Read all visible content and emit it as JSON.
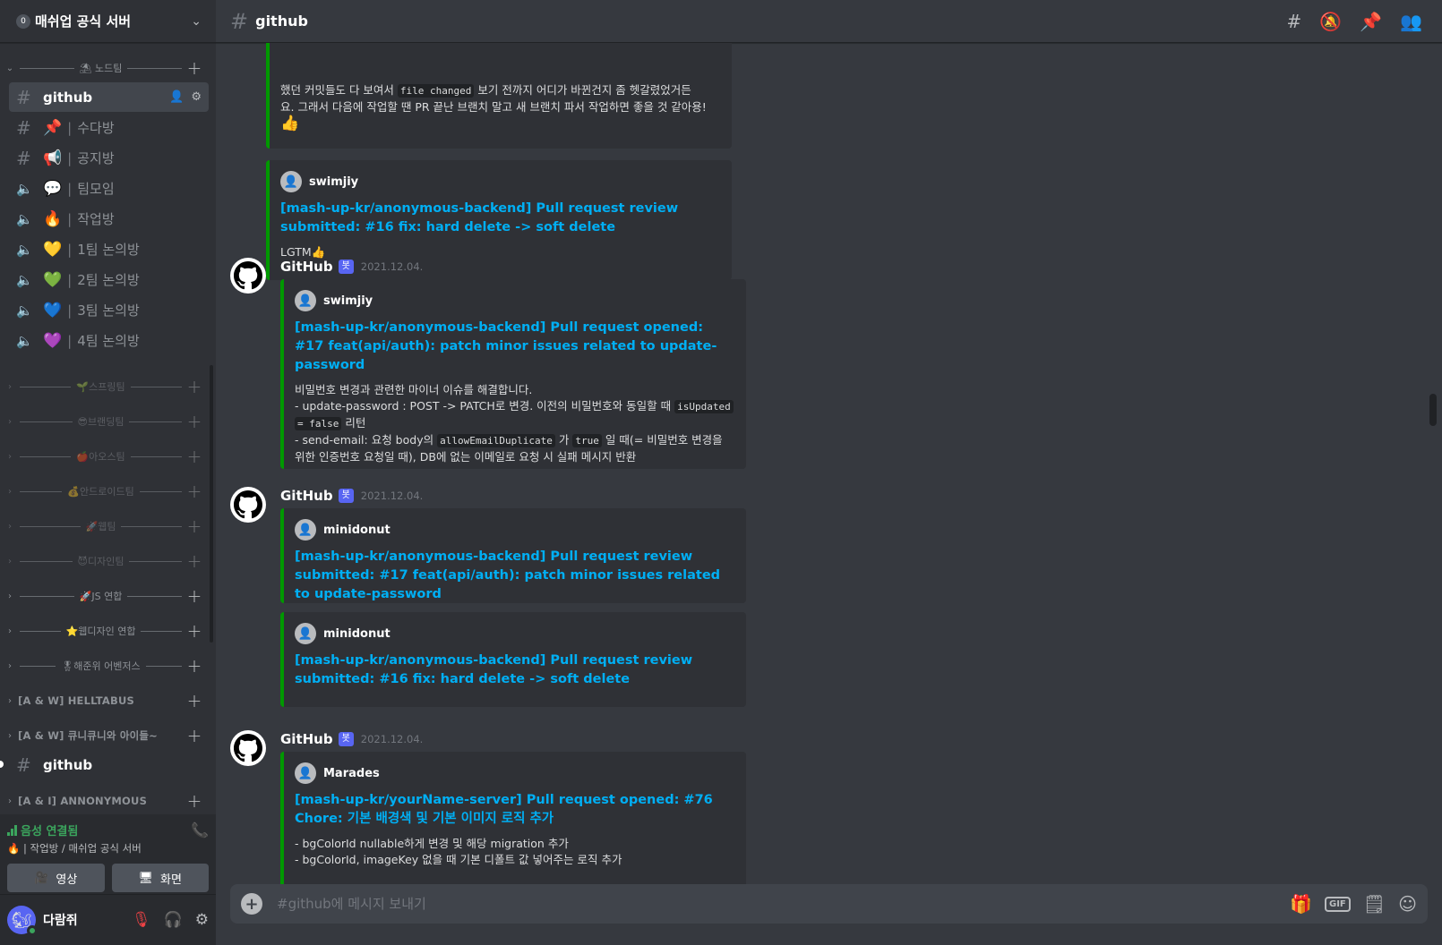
{
  "server": {
    "name": "매쉬업 공식 서버",
    "boost": "0"
  },
  "categories": {
    "nodeteam": "⛱ 노드팀",
    "spring": "🌱스프링팀",
    "brand": "😎브랜딩팀",
    "ios": "🍎아오스팀",
    "android": "💰안드로이드팀",
    "web": "🚀웹팀",
    "design": "😈디자인팀",
    "js": "🚀JS 연합",
    "webdesign": "⭐웹디자인 연합",
    "avengers": "🎖해준위 어벤저스",
    "helltabus": "[A & W] HELLTABUS",
    "kyuni": "[A & W] 큐니큐니와 아이들~",
    "anon": "[A & I] ANNONYMOUS"
  },
  "channels": {
    "github": "github",
    "chat": "수다방",
    "notice": "공지방",
    "meet": "팀모임",
    "work": "작업방",
    "team1": "1팀 논의방",
    "team2": "2팀 논의방",
    "team3": "3팀 논의방",
    "team4": "4팀 논의방",
    "github2": "github"
  },
  "voice": {
    "status": "음성 연결됨",
    "location": "작업방 / 매쉬업 공식 서버",
    "video_label": "영상",
    "screen_label": "화면"
  },
  "user": {
    "name": "다람쥐"
  },
  "topbar": {
    "channel": "github"
  },
  "messages": {
    "partial_line1": "했던 커밋들도 다 보여서",
    "partial_code": "file changed",
    "partial_line1b": "보기 전까지 어디가 바뀐건지 좀 헷갈렸었거든",
    "partial_line2": "요. 그래서 다음에 작업할 땐 PR 끝난 브랜치 말고 새 브랜치 파서 작업하면 좋을 것 같아용!",
    "embed1": {
      "author": "swimjiy",
      "title": "[mash-up-kr/anonymous-backend] Pull request review submitted: #16 fix: hard delete -> soft delete",
      "desc": "LGTM👍"
    },
    "msg2": {
      "author": "GitHub",
      "bot": "봇",
      "time": "2021.12.04.",
      "embed_author": "swimjiy",
      "title": "[mash-up-kr/anonymous-backend] Pull request opened: #17 feat(api/auth): patch minor issues related to update-password",
      "d1": "비밀번호 변경과 관련한 마이너 이슈를 해결합니다.",
      "d2a": "- update-password : POST -> PATCH로 변경. 이전의 비밀번호와 동일할 때",
      "d2code1": "isUpdated",
      "d2code2": "= false",
      "d2b": "리턴",
      "d3a": "- send-email: 요청 body의",
      "d3code1": "allowEmailDuplicate",
      "d3b": "가",
      "d3code2": "true",
      "d3c": "일 때(= 비밀번호 변경을",
      "d4": "위한 인증번호 요청일 때), DB에 없는 이메일로 요청 시 실패 메시지 반환"
    },
    "msg3": {
      "author": "GitHub",
      "bot": "봇",
      "time": "2021.12.04.",
      "e1_author": "minidonut",
      "e1_title": "[mash-up-kr/anonymous-backend] Pull request review submitted: #17 feat(api/auth): patch minor issues related to update-password",
      "e2_author": "minidonut",
      "e2_title": "[mash-up-kr/anonymous-backend] Pull request review submitted: #16 fix: hard delete -> soft delete"
    },
    "msg4": {
      "author": "GitHub",
      "bot": "봇",
      "time": "2021.12.04.",
      "embed_author": "Marades",
      "title": "[mash-up-kr/yourName-server] Pull request opened: #76 Chore: 기본 배경색 및 기본 이미지 로직 추가",
      "d1": "- bgColorId nullable하게 변경 및 해당 migration 추가",
      "d2": "- bgColorId, imageKey 없을 때 기본 디폴트 값 넣어주는 로직 추가"
    }
  },
  "composer": {
    "placeholder": "#github에 메시지 보내기"
  },
  "colors": {
    "embed_border": "#009800",
    "link": "#00aff4",
    "blurple": "#5865f2",
    "online": "#3ba55d"
  }
}
